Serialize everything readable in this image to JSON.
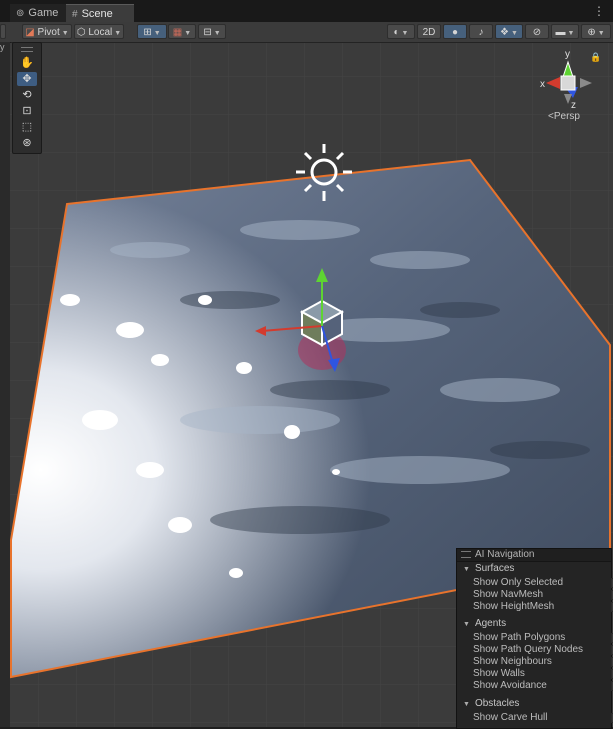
{
  "tabs": [
    {
      "label": "Game",
      "icon": "gamepad-icon"
    },
    {
      "label": "Scene",
      "icon": "grid-icon"
    }
  ],
  "toolbar": {
    "pivot": "Pivot",
    "local": "Local",
    "mode_2d": "2D"
  },
  "left_strip_label": "y",
  "gizmo": {
    "x": "x",
    "y": "y",
    "z": "z",
    "persp": "Persp"
  },
  "ai_navigation": {
    "title": "AI Navigation",
    "sections": [
      {
        "label": "Surfaces",
        "items": [
          {
            "label": "Show Only Selected",
            "checked": true
          },
          {
            "label": "Show NavMesh",
            "checked": true
          },
          {
            "label": "Show HeightMesh",
            "checked": false
          }
        ]
      },
      {
        "label": "Agents",
        "items": [
          {
            "label": "Show Path Polygons",
            "checked": true
          },
          {
            "label": "Show Path Query Nodes",
            "checked": false
          },
          {
            "label": "Show Neighbours",
            "checked": false
          },
          {
            "label": "Show Walls",
            "checked": false
          },
          {
            "label": "Show Avoidance",
            "checked": false
          }
        ]
      },
      {
        "label": "Obstacles",
        "items": [
          {
            "label": "Show Carve Hull",
            "checked": false
          }
        ]
      }
    ]
  },
  "colors": {
    "selection_outline": "#e8732c",
    "axis_x": "#d33b2e",
    "axis_y": "#5ed432",
    "axis_z": "#2f55e0",
    "active_tool": "#3e5d82"
  }
}
